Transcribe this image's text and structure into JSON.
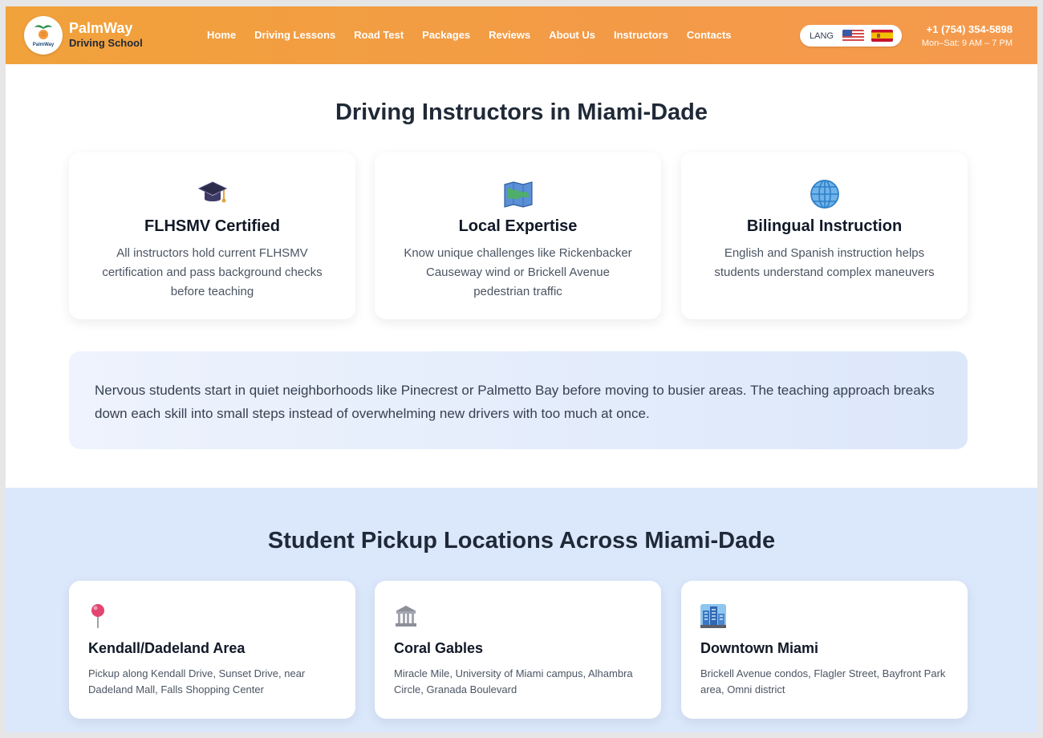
{
  "brand": {
    "name": "PalmWay",
    "subtitle": "Driving School",
    "logo_text": "PalmWay"
  },
  "nav": [
    "Home",
    "Driving Lessons",
    "Road Test",
    "Packages",
    "Reviews",
    "About Us",
    "Instructors",
    "Contacts"
  ],
  "lang": {
    "label": "LANG"
  },
  "contact": {
    "phone": "+1 (754) 354-5898",
    "hours": "Mon–Sat: 9 AM – 7 PM"
  },
  "instructors": {
    "title": "Driving Instructors in Miami-Dade",
    "cards": [
      {
        "icon": "graduation-cap-icon",
        "title": "FLHSMV Certified",
        "text": "All instructors hold current FLHSMV certification and pass background checks before teaching"
      },
      {
        "icon": "map-icon",
        "title": "Local Expertise",
        "text": "Know unique challenges like Rickenbacker Causeway wind or Brickell Avenue pedestrian traffic"
      },
      {
        "icon": "globe-icon",
        "title": "Bilingual Instruction",
        "text": "English and Spanish instruction helps students understand complex maneuvers"
      }
    ],
    "note": "Nervous students start in quiet neighborhoods like Pinecrest or Palmetto Bay before moving to busier areas. The teaching approach breaks down each skill into small steps instead of overwhelming new drivers with too much at once."
  },
  "pickup": {
    "title": "Student Pickup Locations Across Miami-Dade",
    "cards": [
      {
        "icon": "pin-icon",
        "title": "Kendall/Dadeland Area",
        "text": "Pickup along Kendall Drive, Sunset Drive, near Dadeland Mall, Falls Shopping Center"
      },
      {
        "icon": "classical-building-icon",
        "title": "Coral Gables",
        "text": "Miracle Mile, University of Miami campus, Alhambra Circle, Granada Boulevard"
      },
      {
        "icon": "cityscape-icon",
        "title": "Downtown Miami",
        "text": "Brickell Avenue condos, Flagler Street, Bayfront Park area, Omni district"
      }
    ]
  },
  "colors": {
    "header_start": "#f1a23b",
    "header_end": "#f59a4d",
    "section_bg": "#dbe7fb",
    "note_bg": "#e3ecfb"
  }
}
